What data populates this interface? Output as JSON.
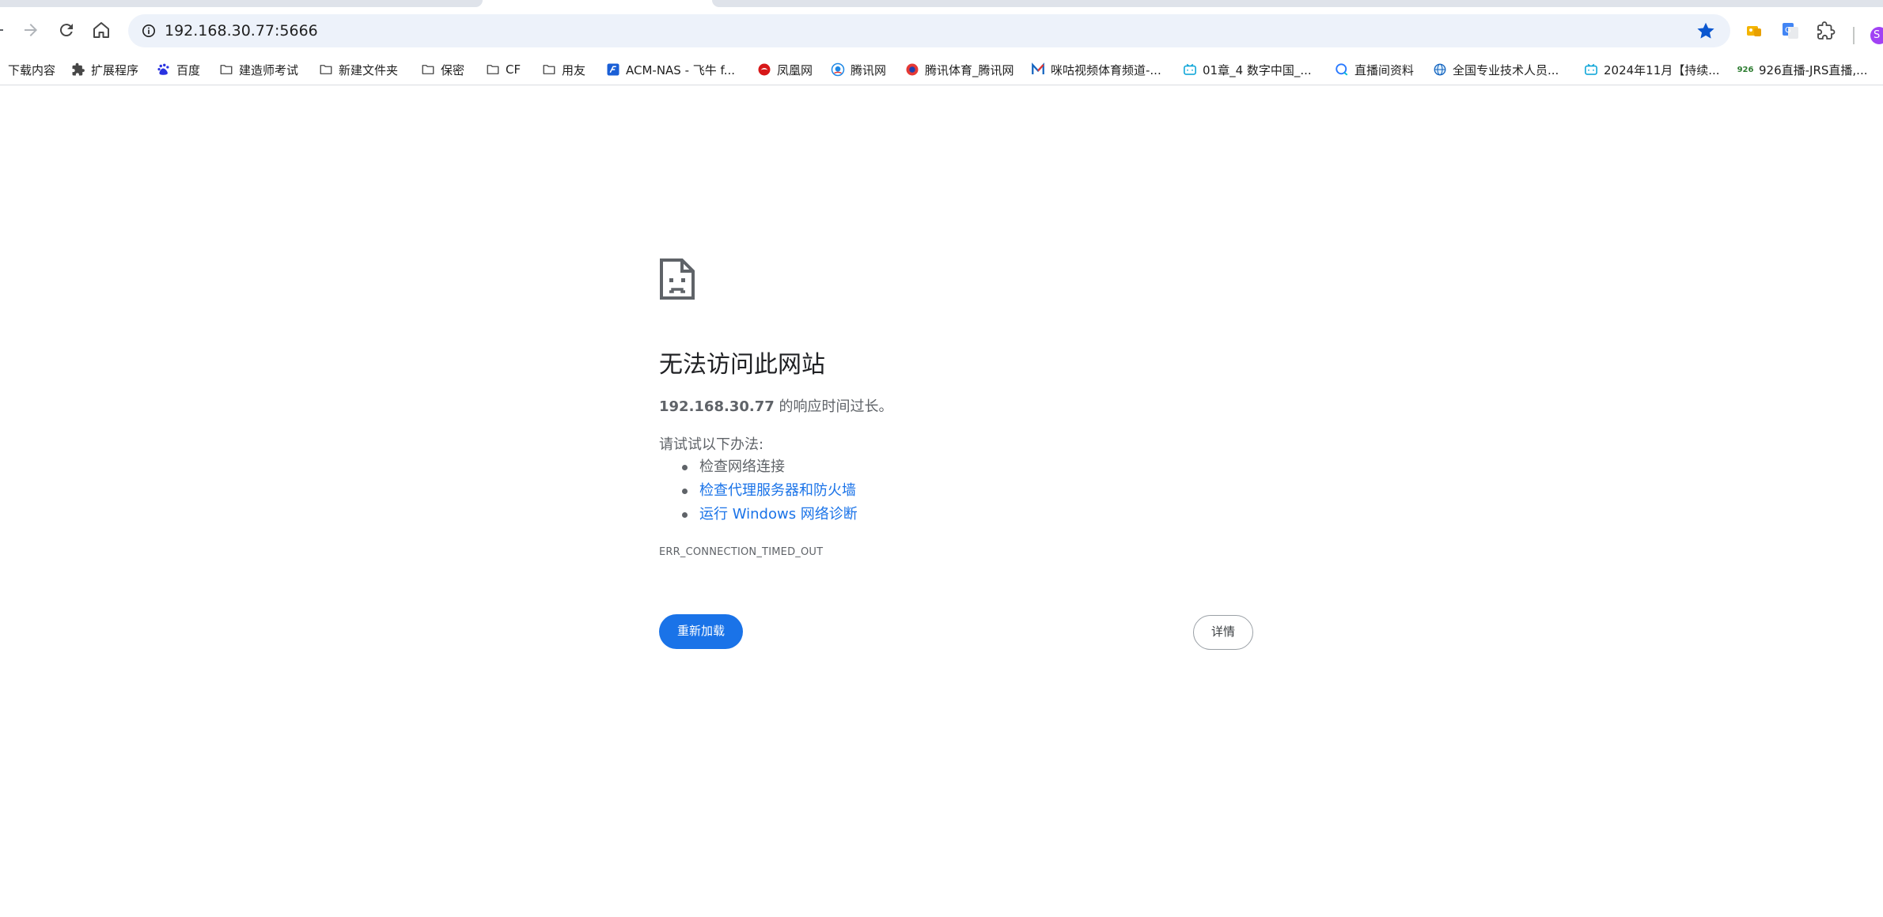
{
  "browser": {
    "address_bar": {
      "url": "192.168.30.77:5666"
    },
    "accent_color": "#1a73e8",
    "profile_initial": "S"
  },
  "bookmarks": [
    {
      "label": "下载内容",
      "icon": "none"
    },
    {
      "label": "扩展程序",
      "icon": "puzzle-icon"
    },
    {
      "label": "百度",
      "icon": "baidu-paw-icon"
    },
    {
      "label": "建造师考试",
      "icon": "folder-icon"
    },
    {
      "label": "新建文件夹",
      "icon": "folder-icon"
    },
    {
      "label": "保密",
      "icon": "folder-icon"
    },
    {
      "label": "CF",
      "icon": "folder-icon"
    },
    {
      "label": "用友",
      "icon": "folder-icon"
    },
    {
      "label": "ACM-NAS - 飞牛 f...",
      "icon": "fnos-icon"
    },
    {
      "label": "凤凰网",
      "icon": "ifeng-icon"
    },
    {
      "label": "腾讯网",
      "icon": "qq-icon"
    },
    {
      "label": "腾讯体育_腾讯网",
      "icon": "qq-sports-icon"
    },
    {
      "label": "咪咕视频体育频道-...",
      "icon": "migu-icon"
    },
    {
      "label": "01章_4 数字中国_...",
      "icon": "bilibili-icon"
    },
    {
      "label": "直播间资料",
      "icon": "chat-bubble-icon"
    },
    {
      "label": "全国专业技术人员...",
      "icon": "globe-icon"
    },
    {
      "label": "2024年11月【持续...",
      "icon": "bilibili-icon"
    },
    {
      "label": "926直播-JRS直播,...",
      "icon": "jrs-926-icon"
    }
  ],
  "error_page": {
    "title": "无法访问此网站",
    "host": "192.168.30.77",
    "desc_suffix": " 的响应时间过长。",
    "try_heading": "请试试以下办法:",
    "suggestions": [
      {
        "text": "检查网络连接",
        "is_link": false
      },
      {
        "text": "检查代理服务器和防火墙",
        "is_link": true
      },
      {
        "text": "运行 Windows 网络诊断",
        "is_link": true
      }
    ],
    "error_code": "ERR_CONNECTION_TIMED_OUT",
    "reload_label": "重新加载",
    "details_label": "详情"
  }
}
